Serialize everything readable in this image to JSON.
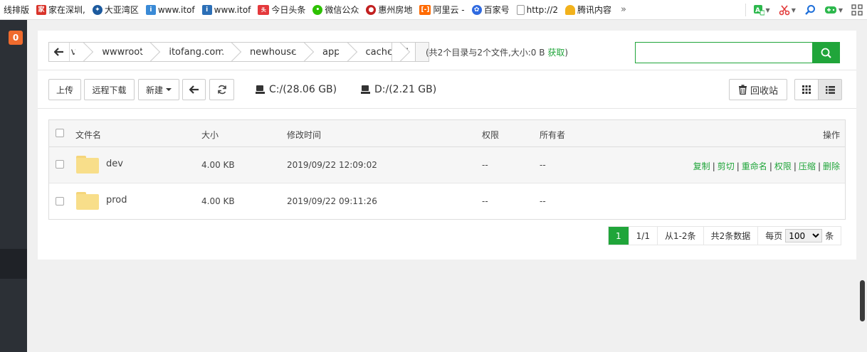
{
  "bookmarks": [
    {
      "label": "线排版",
      "icon": "none",
      "color": ""
    },
    {
      "label": "家在深圳,",
      "icon": "house-logo-icon",
      "color": "#d9342b"
    },
    {
      "label": "大亚湾区",
      "icon": "town-logo-icon",
      "color": "#1c5a9e"
    },
    {
      "label": "www.itof",
      "icon": "site-logo-icon",
      "color": "#3a8ad6"
    },
    {
      "label": "www.itof",
      "icon": "site-logo-icon",
      "color": "#2c6fb7"
    },
    {
      "label": "今日头条",
      "icon": "toutiao-logo-icon",
      "color": "#e4393c"
    },
    {
      "label": "微信公众",
      "icon": "wechat-logo-icon",
      "color": "#2dc100"
    },
    {
      "label": "惠州房地",
      "icon": "realestate-logo-icon",
      "color": "#c22020"
    },
    {
      "label": "阿里云 -",
      "icon": "aliyun-logo-icon",
      "color": "#ff6a00"
    },
    {
      "label": "百家号",
      "icon": "baidu-paw-icon",
      "color": "#2f6ae0"
    },
    {
      "label": "http://2",
      "icon": "page-icon",
      "color": "#999999"
    },
    {
      "label": "腾讯内容",
      "icon": "bell-icon",
      "color": "#f2b21c"
    }
  ],
  "bookmarks_more": "»",
  "sidebar": {
    "badge": "0"
  },
  "path": {
    "crumbs": [
      "v",
      "wwwroot",
      "itofang.com",
      "newhouse",
      "app",
      "cache"
    ],
    "info_prefix": "(共2个目录与2个文件,大小:0 B",
    "fetch_label": "获取",
    "info_suffix": ")"
  },
  "search": {
    "value": "",
    "placeholder": ""
  },
  "toolbar": {
    "upload": "上传",
    "remote_download": "远程下载",
    "new": "新建",
    "disks": [
      "C:/(28.06 GB)",
      "D:/(2.21 GB)"
    ],
    "recycle": "回收站"
  },
  "table": {
    "headers": {
      "name": "文件名",
      "size": "大小",
      "mtime": "修改时间",
      "perm": "权限",
      "owner": "所有者",
      "ops": "操作"
    },
    "rows": [
      {
        "name": "dev",
        "size": "4.00 KB",
        "mtime": "2019/09/22 12:09:02",
        "perm": "--",
        "owner": "--"
      },
      {
        "name": "prod",
        "size": "4.00 KB",
        "mtime": "2019/09/22 09:11:26",
        "perm": "--",
        "owner": "--"
      }
    ],
    "ops": [
      "复制",
      "剪切",
      "重命名",
      "权限",
      "压缩",
      "删除"
    ]
  },
  "pager": {
    "current": "1",
    "pages": "1/1",
    "range": "从1-2条",
    "total": "共2条数据",
    "per_page_label": "每页",
    "per_page": "100",
    "unit": "条"
  },
  "colors": {
    "accent": "#20a53a",
    "sidebar": "#2c3036",
    "badge": "#f06b2d"
  }
}
